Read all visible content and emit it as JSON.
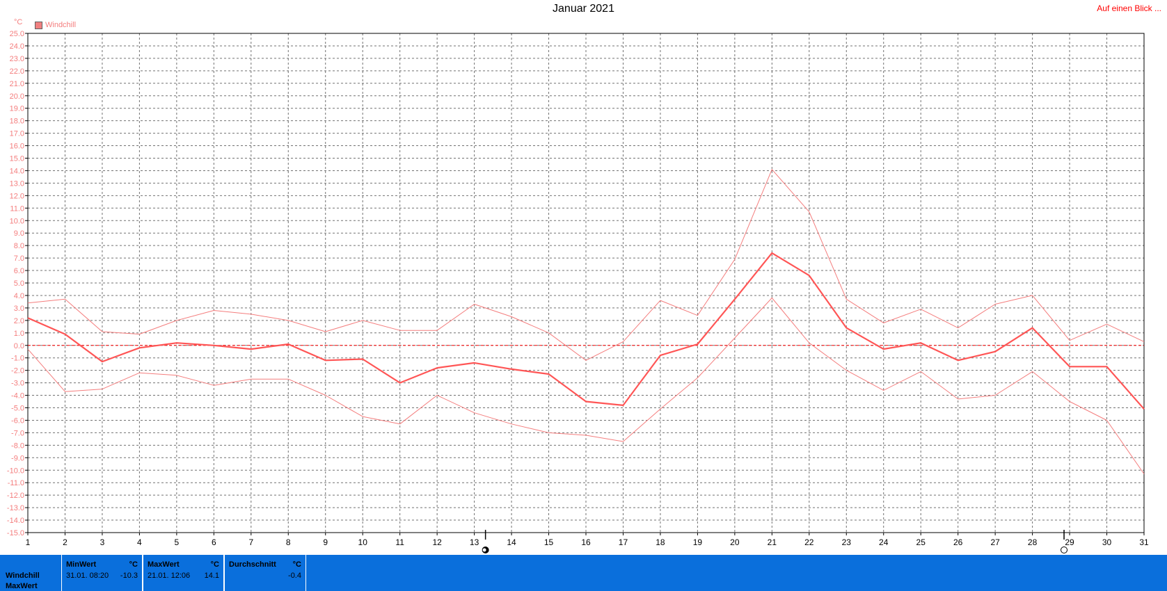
{
  "header": {
    "title": "Januar 2021",
    "link_label": "Auf einen Blick ..."
  },
  "legend": {
    "label": "Windchill",
    "color": "#f08080"
  },
  "chart_data": {
    "type": "line",
    "title": "Januar 2021",
    "ylabel": "°C",
    "xlabel": "",
    "x": [
      1,
      2,
      3,
      4,
      5,
      6,
      7,
      8,
      9,
      10,
      11,
      12,
      13,
      14,
      15,
      16,
      17,
      18,
      19,
      20,
      21,
      22,
      23,
      24,
      25,
      26,
      27,
      28,
      29,
      30,
      31
    ],
    "ylim": [
      -15.0,
      25.0
    ],
    "ytick_step": 1.0,
    "grid": true,
    "legend_position": "top-left",
    "zero_line": true,
    "series": [
      {
        "name": "Windchill",
        "role": "max",
        "color": "#f47d7d",
        "values": [
          3.4,
          3.7,
          1.1,
          0.9,
          2.0,
          2.8,
          2.5,
          2.0,
          1.1,
          2.0,
          1.2,
          1.2,
          3.3,
          2.3,
          1.0,
          -1.2,
          0.3,
          3.6,
          2.4,
          6.9,
          14.1,
          10.7,
          3.7,
          1.8,
          2.9,
          1.4,
          3.3,
          4.0,
          0.4,
          1.7,
          0.3
        ]
      },
      {
        "name": "Windchill",
        "role": "avg",
        "color": "#ff5555",
        "values": [
          2.2,
          0.9,
          -1.3,
          -0.2,
          0.2,
          0.0,
          -0.3,
          0.1,
          -1.2,
          -1.1,
          -3.0,
          -1.8,
          -1.4,
          -1.9,
          -2.3,
          -4.5,
          -4.8,
          -0.8,
          0.1,
          3.7,
          7.4,
          5.6,
          1.4,
          -0.3,
          0.2,
          -1.2,
          -0.5,
          1.4,
          -1.7,
          -1.7,
          -5.1
        ]
      },
      {
        "name": "Windchill",
        "role": "min",
        "color": "#f47d7d",
        "values": [
          -0.3,
          -3.7,
          -3.5,
          -2.2,
          -2.4,
          -3.2,
          -2.7,
          -2.7,
          -4.0,
          -5.7,
          -6.3,
          -4.0,
          -5.4,
          -6.3,
          -7.0,
          -7.2,
          -7.7,
          -5.1,
          -2.6,
          0.6,
          3.8,
          0.2,
          -2.0,
          -3.6,
          -2.1,
          -4.3,
          -4.0,
          -2.1,
          -4.5,
          -6.0,
          -10.3
        ]
      }
    ],
    "markers": [
      {
        "x": 13.3,
        "label": "full-moon"
      },
      {
        "x": 28.85,
        "label": "new-moon"
      }
    ]
  },
  "stats": {
    "row_labels": [
      "Windchill",
      "MaxWert"
    ],
    "boxes": [
      {
        "header": "MinWert",
        "unit": "°C",
        "date": "31.01.  08:20",
        "value": "-10.3"
      },
      {
        "header": "MaxWert",
        "unit": "°C",
        "date": "21.01.  12:06",
        "value": "14.1"
      },
      {
        "header": "Durchschnitt",
        "unit": "°C",
        "date": "",
        "value": "-0.4"
      }
    ]
  }
}
